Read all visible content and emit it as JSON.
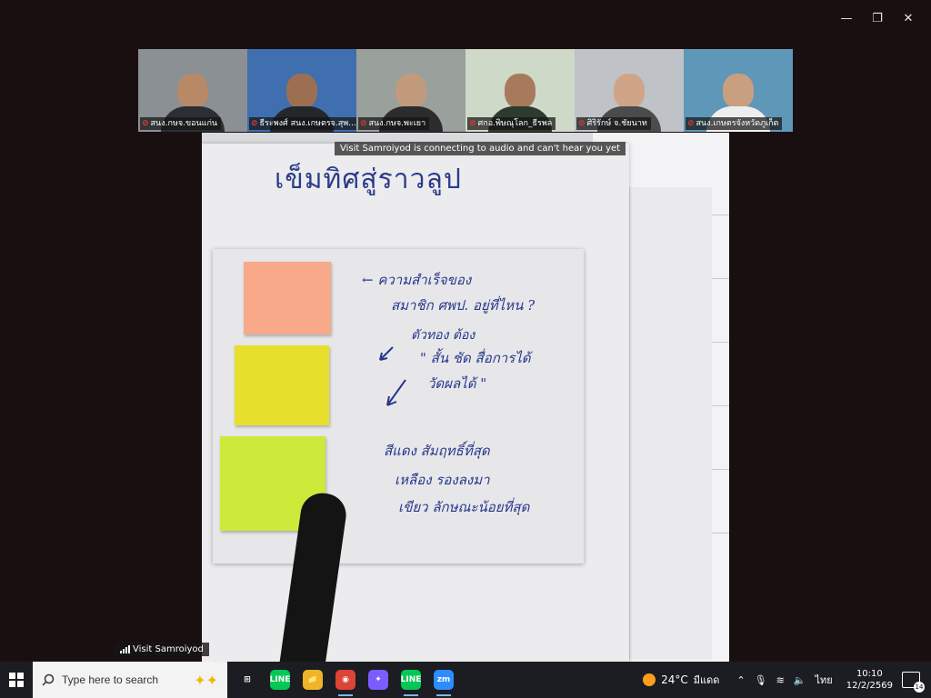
{
  "window": {
    "minimize": "—",
    "restore": "❐",
    "close": "✕"
  },
  "participants": [
    {
      "name": "สนง.กษจ.ขอนแก่น",
      "muted": true,
      "bg": "#8a9094",
      "skin": "#b88966",
      "shirt": "#2b2f35"
    },
    {
      "name": "ธีระพงศ์ สนง.เกษตรจ.สุพ...",
      "muted": true,
      "bg": "#3f6fae",
      "skin": "#9c6f52",
      "shirt": "#23272c"
    },
    {
      "name": "สนง.กษจ.พะเยา",
      "muted": true,
      "bg": "#9aa09c",
      "skin": "#c29a7c",
      "shirt": "#2c2c2c"
    },
    {
      "name": "ศกอ.พิษณุโลก_ธีรพล",
      "muted": true,
      "bg": "#cfd9c8",
      "skin": "#a87a5c",
      "shirt": "#2d3a2e"
    },
    {
      "name": "ศิริรักษ์ จ.ชัยนาท",
      "muted": true,
      "bg": "#bfc3c7",
      "skin": "#d0a487",
      "shirt": "#4b4b4b"
    },
    {
      "name": "สนง.เกษตรจังหวัดภูเก็ต",
      "muted": true,
      "bg": "#5f97b8",
      "skin": "#c8a080",
      "shirt": "#eeeeee"
    }
  ],
  "share": {
    "title": "เข็มทิศสู่ราวลูป",
    "notes": [
      "← ความสำเร็จของ",
      "สมาชิก ศพป. อยู่ที่ไหน ?",
      "ตัวทอง ต้อง",
      "\" สั้น ชัด สื่อการได้",
      "วัดผลได้ \"",
      "สีแดง สัมฤทธิ์ที่สุด",
      "เหลือง รองลงมา",
      "เขียว ลักษณะน้อยที่สุด"
    ],
    "sticky_colors": [
      "#f7a98a",
      "#e6e02c",
      "#cde93a"
    ]
  },
  "banner": "Visit Samroiyod is connecting to audio and can't hear you yet",
  "audio_label": "Visit Samroiyod",
  "taskbar": {
    "search_placeholder": "Type here to search",
    "apps": [
      {
        "icon": "task-view-icon",
        "label": "⊞",
        "color": "transparent",
        "active": false
      },
      {
        "icon": "line-icon",
        "label": "LINE",
        "color": "#06c755",
        "active": false
      },
      {
        "icon": "file-explorer-icon",
        "label": "📁",
        "color": "#f0b429",
        "active": false
      },
      {
        "icon": "chrome-icon",
        "label": "◉",
        "color": "#db4437",
        "active": true
      },
      {
        "icon": "copilot-icon",
        "label": "✦",
        "color": "#7b5cff",
        "active": false
      },
      {
        "icon": "line-icon-2",
        "label": "LINE",
        "color": "#06c755",
        "active": true
      },
      {
        "icon": "zoom-icon",
        "label": "zm",
        "color": "#2d8cff",
        "active": true
      }
    ],
    "weather_temp": "24°C",
    "weather_desc": "มีแดด",
    "lang": "ไทย",
    "time": "10:10",
    "date": "12/2/2569",
    "notifications": "14"
  }
}
